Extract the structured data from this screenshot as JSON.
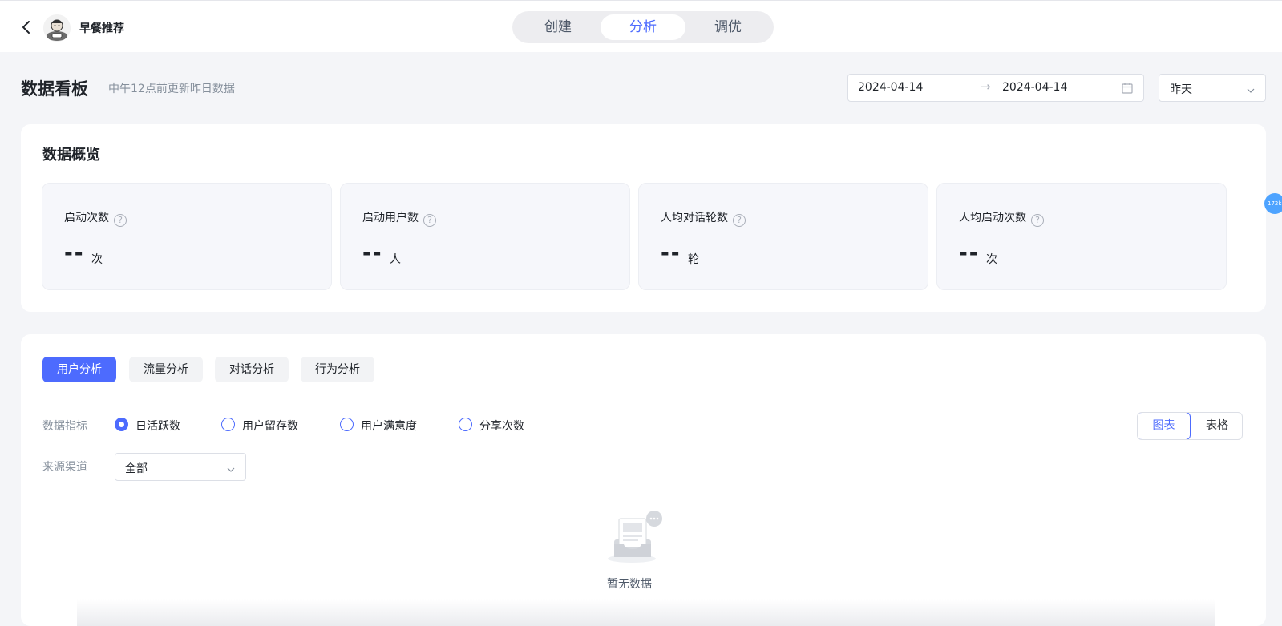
{
  "header": {
    "bot_name": "早餐推荐",
    "tabs": [
      {
        "label": "创建",
        "active": false
      },
      {
        "label": "分析",
        "active": true
      },
      {
        "label": "调优",
        "active": false
      }
    ]
  },
  "dashboard": {
    "title": "数据看板",
    "subtitle": "中午12点前更新昨日数据",
    "date_start": "2024-04-14",
    "date_arrow": "→",
    "date_end": "2024-04-14",
    "period": "昨天"
  },
  "overview": {
    "title": "数据概览",
    "stats": [
      {
        "label": "启动次数",
        "value": "--",
        "unit": "次"
      },
      {
        "label": "启动用户数",
        "value": "--",
        "unit": "人"
      },
      {
        "label": "人均对话轮数",
        "value": "--",
        "unit": "轮"
      },
      {
        "label": "人均启动次数",
        "value": "--",
        "unit": "次"
      }
    ]
  },
  "side_bubble": "172k",
  "analysis": {
    "tabs": [
      "用户分析",
      "流量分析",
      "对话分析",
      "行为分析"
    ],
    "metric_label": "数据指标",
    "metrics": [
      "日活跃数",
      "用户留存数",
      "用户满意度",
      "分享次数"
    ],
    "selected_metric": "日活跃数",
    "view_chart": "图表",
    "view_table": "表格",
    "channel_label": "来源渠道",
    "channel_value": "全部",
    "empty_text": "暂无数据"
  },
  "colors": {
    "accent": "#4d6bfe",
    "background": "#f4f5f8",
    "stat_card": "#f6f7fb"
  }
}
